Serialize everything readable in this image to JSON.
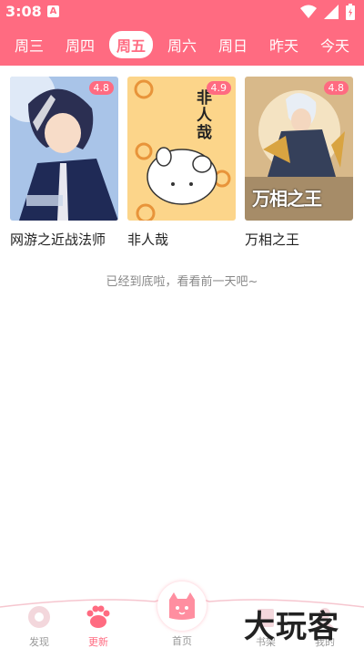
{
  "status": {
    "time": "3:08",
    "notif_glyph": "A"
  },
  "day_tabs": [
    {
      "label": "周三",
      "active": false
    },
    {
      "label": "周四",
      "active": false
    },
    {
      "label": "周五",
      "active": true
    },
    {
      "label": "周六",
      "active": false
    },
    {
      "label": "周日",
      "active": false
    },
    {
      "label": "昨天",
      "active": false
    },
    {
      "label": "今天",
      "active": false
    }
  ],
  "comics": [
    {
      "title": "网游之近战法师",
      "rating": "4.8",
      "cover_icon": "cover-anime-swordsman"
    },
    {
      "title": "非人哉",
      "rating": "4.9",
      "cover_icon": "cover-feirenzai",
      "cover_text": "非人哉"
    },
    {
      "title": "万相之王",
      "rating": "4.8",
      "cover_icon": "cover-wanxiang",
      "cover_text": "万相之王"
    }
  ],
  "end_message": "已经到底啦，看看前一天吧~",
  "bottom_nav": {
    "discover": "发现",
    "update": "更新",
    "home": "首页",
    "bookshelf": "书架",
    "mine": "我的"
  },
  "watermark": "大玩客",
  "colors": {
    "accent": "#ff6b81",
    "text": "#222222",
    "muted": "#888888"
  }
}
